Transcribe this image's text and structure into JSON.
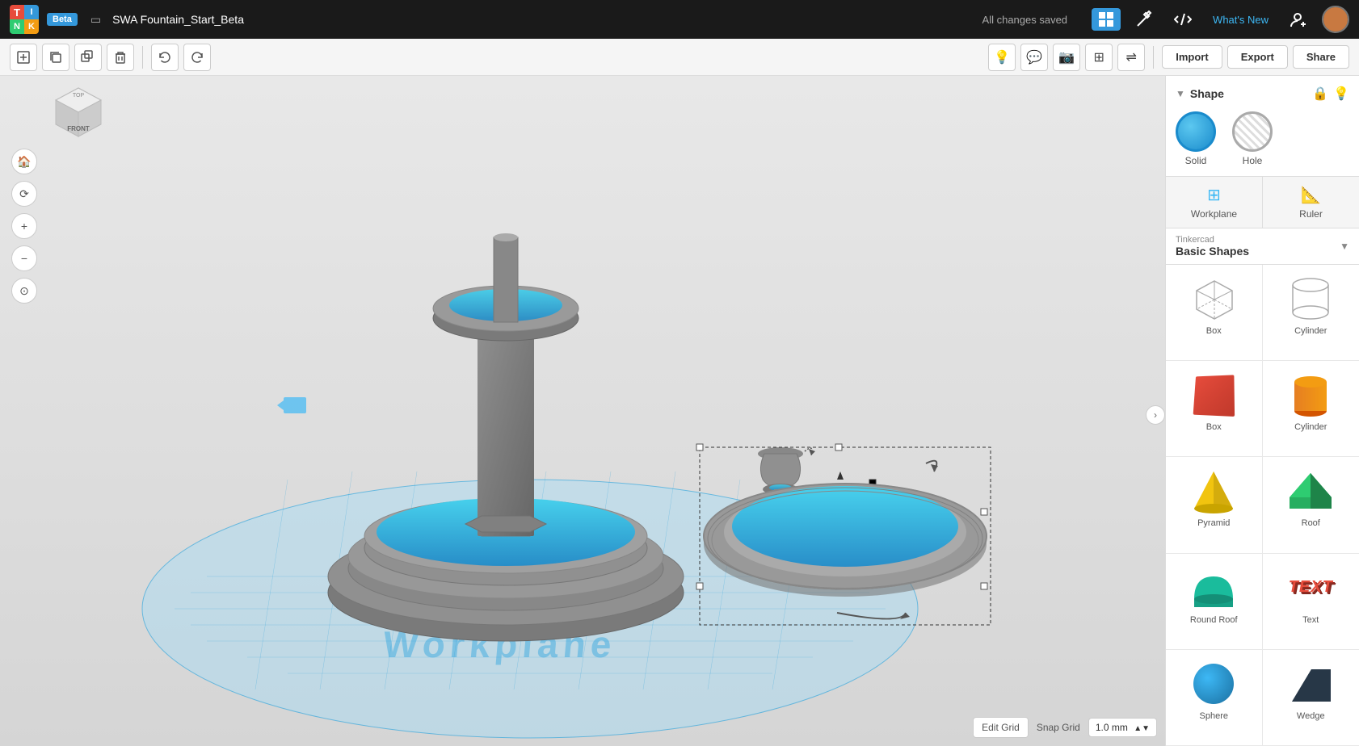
{
  "app": {
    "logo": {
      "t": "T",
      "i": "I",
      "n": "N",
      "k": "K"
    },
    "beta_label": "Beta",
    "file_title": "SWA Fountain_Start_Beta",
    "saved_status": "All changes saved",
    "whats_new": "What's New"
  },
  "toolbar": {
    "import_label": "Import",
    "export_label": "Export",
    "share_label": "Share"
  },
  "shape_panel": {
    "title": "Shape",
    "solid_label": "Solid",
    "hole_label": "Hole"
  },
  "tabs": {
    "workplane_label": "Workplane",
    "ruler_label": "Ruler"
  },
  "shapes_library": {
    "provider": "Tinkercad",
    "category": "Basic Shapes",
    "items": [
      {
        "name": "Box",
        "type": "box-wire",
        "colored": false
      },
      {
        "name": "Cylinder",
        "type": "cyl-wire",
        "colored": false
      },
      {
        "name": "Box",
        "type": "box-red",
        "colored": true
      },
      {
        "name": "Cylinder",
        "type": "cyl-orange",
        "colored": true
      },
      {
        "name": "Pyramid",
        "type": "pyramid-yellow",
        "colored": true
      },
      {
        "name": "Roof",
        "type": "roof-green",
        "colored": true
      },
      {
        "name": "Round Roof",
        "type": "round-roof-teal",
        "colored": true
      },
      {
        "name": "Text",
        "type": "text-red",
        "colored": true
      },
      {
        "name": "Sphere",
        "type": "sphere-blue",
        "colored": true
      },
      {
        "name": "Wedge",
        "type": "wedge-dark",
        "colored": true
      }
    ]
  },
  "viewport": {
    "workplane_label": "Workplane",
    "edit_grid_label": "Edit Grid",
    "snap_grid_label": "Snap Grid",
    "snap_grid_value": "1.0 mm"
  }
}
